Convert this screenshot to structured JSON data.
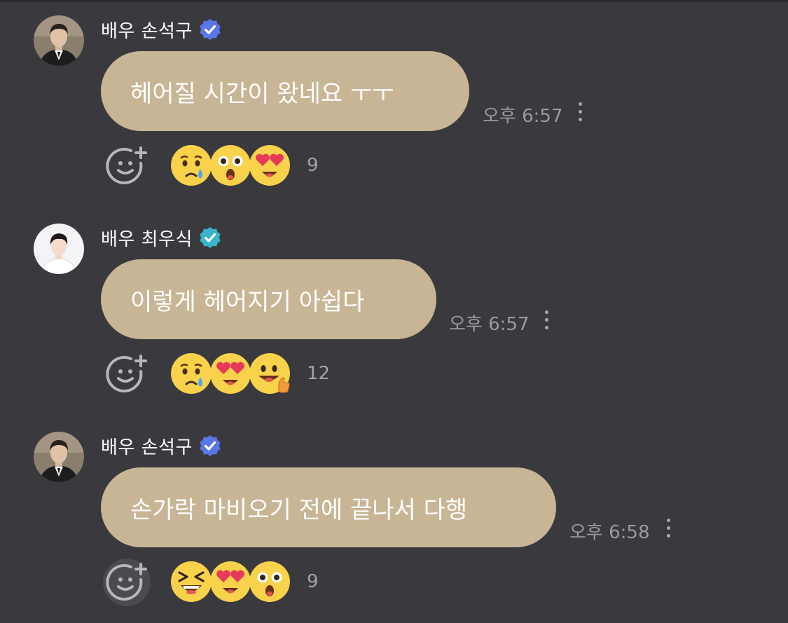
{
  "messages": [
    {
      "author": "배우 손석구",
      "avatar": "man-in-suit-avatar",
      "verified_color": "#5a76e8",
      "text": "헤어질 시간이 왔네요 ㅜㅜ",
      "time": "오후 6:57",
      "reactions": [
        "crying-face",
        "astonished-face",
        "heart-eyes-face"
      ],
      "reaction_count": "9"
    },
    {
      "author": "배우 최우식",
      "avatar": "man-white-background-avatar",
      "verified_color": "#3bb3c9",
      "text": "이렇게 헤어지기 아쉽다",
      "time": "오후 6:57",
      "reactions": [
        "crying-face",
        "heart-eyes-face",
        "thumbs-up-face"
      ],
      "reaction_count": "12"
    },
    {
      "author": "배우 손석구",
      "avatar": "man-in-suit-avatar",
      "verified_color": "#5a76e8",
      "text": "손가락 마비오기 전에 끝나서 다행",
      "time": "오후 6:58",
      "reactions": [
        "laughing-face",
        "heart-eyes-face",
        "astonished-face"
      ],
      "reaction_count": "9"
    }
  ],
  "colors": {
    "background": "#3a393e",
    "bubble": "#c7b595",
    "text": "#ffffff",
    "meta": "#9b9aa0"
  }
}
